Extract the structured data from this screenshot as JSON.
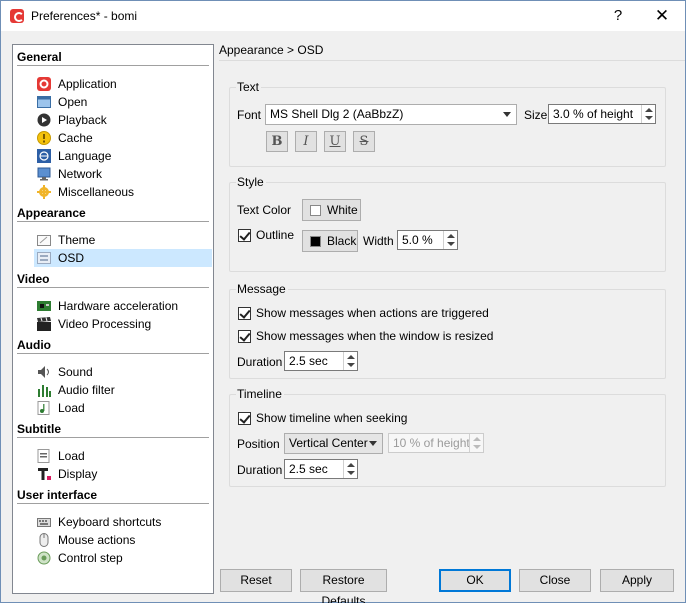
{
  "window": {
    "title": "Preferences* - bomi",
    "help_label": "?",
    "close_label": "✕"
  },
  "sidebar": {
    "categories": [
      {
        "label": "General",
        "items": [
          {
            "label": "Application",
            "icon": "bomi-app-icon"
          },
          {
            "label": "Open",
            "icon": "open-window-icon"
          },
          {
            "label": "Playback",
            "icon": "play-icon"
          },
          {
            "label": "Cache",
            "icon": "cache-icon"
          },
          {
            "label": "Language",
            "icon": "language-icon"
          },
          {
            "label": "Network",
            "icon": "network-icon"
          },
          {
            "label": "Miscellaneous",
            "icon": "misc-gear-icon"
          }
        ]
      },
      {
        "label": "Appearance",
        "items": [
          {
            "label": "Theme",
            "icon": "theme-icon"
          },
          {
            "label": "OSD",
            "icon": "osd-icon",
            "selected": true
          }
        ]
      },
      {
        "label": "Video",
        "items": [
          {
            "label": "Hardware acceleration",
            "icon": "hardware-board-icon"
          },
          {
            "label": "Video Processing",
            "icon": "film-clapper-icon"
          }
        ]
      },
      {
        "label": "Audio",
        "items": [
          {
            "label": "Sound",
            "icon": "speaker-icon"
          },
          {
            "label": "Audio filter",
            "icon": "equalizer-icon"
          },
          {
            "label": "Load",
            "icon": "music-note-icon"
          }
        ]
      },
      {
        "label": "Subtitle",
        "items": [
          {
            "label": "Load",
            "icon": "subtitle-load-icon"
          },
          {
            "label": "Display",
            "icon": "text-t-icon"
          }
        ]
      },
      {
        "label": "User interface",
        "items": [
          {
            "label": "Keyboard shortcuts",
            "icon": "keyboard-icon"
          },
          {
            "label": "Mouse actions",
            "icon": "mouse-icon"
          },
          {
            "label": "Control step",
            "icon": "control-step-icon"
          }
        ]
      }
    ]
  },
  "breadcrumb": "Appearance > OSD",
  "text_group": {
    "title": "Text",
    "font_label": "Font",
    "font_value": "MS Shell Dlg 2 (AaBbzZ)",
    "size_label": "Size",
    "size_value": "3.0 % of height",
    "format_buttons": [
      "B",
      "I",
      "U",
      "S"
    ]
  },
  "style_group": {
    "title": "Style",
    "text_color_label": "Text Color",
    "text_color_value": "White",
    "text_color_swatch": "#ffffff",
    "outline_label": "Outline",
    "outline_checked": true,
    "outline_color_value": "Black",
    "outline_color_swatch": "#000000",
    "width_label": "Width",
    "width_value": "5.0 %"
  },
  "message_group": {
    "title": "Message",
    "show_triggered_label": "Show messages when actions are triggered",
    "show_triggered_checked": true,
    "show_resized_label": "Show messages when the window is resized",
    "show_resized_checked": true,
    "duration_label": "Duration",
    "duration_value": "2.5 sec"
  },
  "timeline_group": {
    "title": "Timeline",
    "show_seeking_label": "Show timeline when seeking",
    "show_seeking_checked": true,
    "position_label": "Position",
    "position_value": "Vertical Center",
    "position_offset_value": "10 % of height",
    "duration_label": "Duration",
    "duration_value": "2.5 sec"
  },
  "buttons": {
    "reset": "Reset",
    "restore_defaults": "Restore Defaults",
    "ok": "OK",
    "close": "Close",
    "apply": "Apply"
  },
  "colors": {
    "selection": "#cce8ff",
    "accent": "#0078d7"
  }
}
